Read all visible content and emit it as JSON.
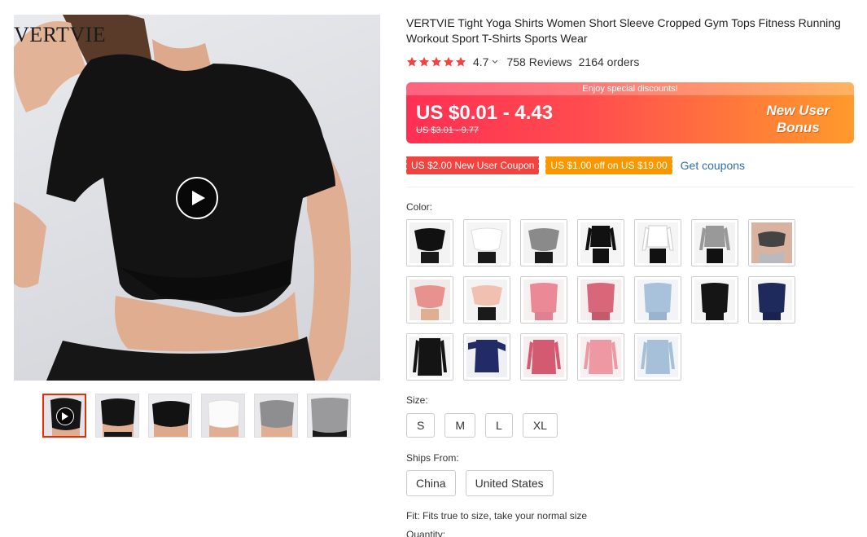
{
  "gallery": {
    "brand": "VERTVIE",
    "thumb_count": 6
  },
  "product": {
    "title": "VERTVIE Tight Yoga Shirts Women Short Sleeve Cropped Gym Tops Fitness Running Workout Sport T-Shirts Sports Wear",
    "rating_value": "4.7",
    "rating_stars": 5,
    "reviews": "758 Reviews",
    "orders": "2164 orders"
  },
  "promo": {
    "banner": "Enjoy special discounts!",
    "price_range": "US $0.01 - 4.43",
    "original_price": "US $3.01 - 9.77",
    "badge_line1": "New User",
    "badge_line2": "Bonus"
  },
  "coupons": {
    "coupon1": "US $2.00 New User Coupon",
    "coupon2": "US $1.00 off on US $19.00",
    "link": "Get coupons"
  },
  "color": {
    "label": "Color:",
    "swatches": [
      "black-crop",
      "white-crop",
      "grey-crop",
      "black-long",
      "white-long",
      "grey-long",
      "sports-bra",
      "pink-crop",
      "nude-crop",
      "pink-tee",
      "rose-tee",
      "light-blue-tee",
      "black-mesh-tee",
      "navy-tee",
      "black-long-back",
      "navy-long",
      "rose-long",
      "pink-long",
      "light-blue-long"
    ]
  },
  "size": {
    "label": "Size:",
    "options": [
      "S",
      "M",
      "L",
      "XL"
    ]
  },
  "ships": {
    "label": "Ships From:",
    "options": [
      "China",
      "United States"
    ]
  },
  "fit_text": "Fit: Fits true to size, take your normal size",
  "quantity_label": "Quantity:",
  "colors": {
    "accent_red": "#e62e04",
    "coupon_red": "#f2433e",
    "coupon_orange": "#f89700",
    "link_blue": "#2e6dbb",
    "star": "#f2433e"
  }
}
